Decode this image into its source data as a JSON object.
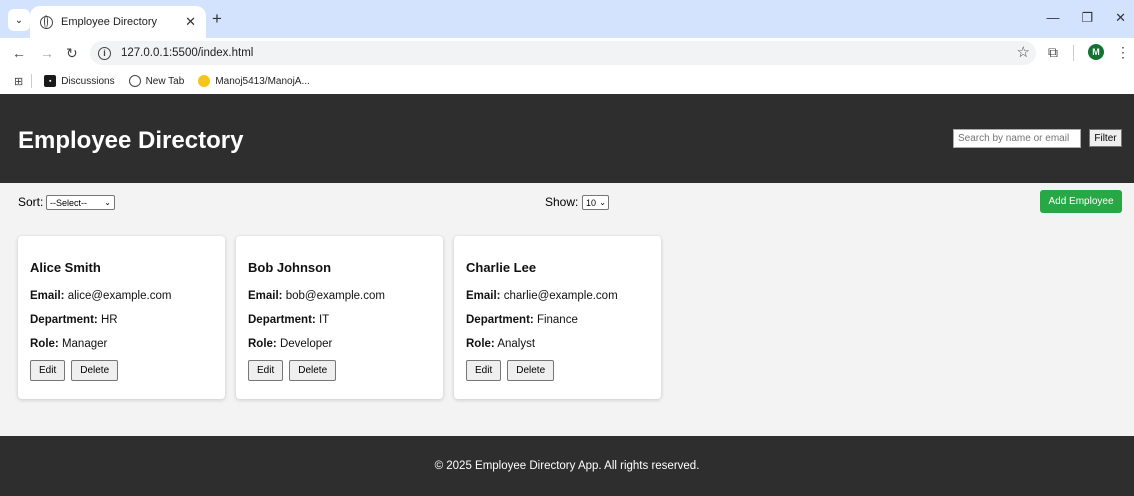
{
  "browser": {
    "tab_title": "Employee Directory",
    "url": "127.0.0.1:5500/index.html",
    "avatar_initial": "M",
    "bookmarks": [
      "Discussions",
      "New Tab",
      "Manoj5413/ManojA..."
    ]
  },
  "header": {
    "title": "Employee Directory",
    "search_placeholder": "Search by name or email",
    "filter_label": "Filter"
  },
  "controls": {
    "sort_label": "Sort:",
    "sort_value": "--Select--",
    "show_label": "Show:",
    "show_value": "10",
    "add_label": "Add Employee"
  },
  "employees": [
    {
      "name": "Alice Smith",
      "email": "alice@example.com",
      "department": "HR",
      "role": "Manager"
    },
    {
      "name": "Bob Johnson",
      "email": "bob@example.com",
      "department": "IT",
      "role": "Developer"
    },
    {
      "name": "Charlie Lee",
      "email": "charlie@example.com",
      "department": "Finance",
      "role": "Analyst"
    }
  ],
  "labels": {
    "email": "Email:",
    "department": "Department:",
    "role": "Role:",
    "edit": "Edit",
    "delete": "Delete"
  },
  "footer": {
    "text": "© 2025 Employee Directory App. All rights reserved."
  },
  "colors": {
    "header_bg": "#2e2e2e",
    "accent_green": "#28a745",
    "browser_tabbar": "#d3e3fd"
  }
}
